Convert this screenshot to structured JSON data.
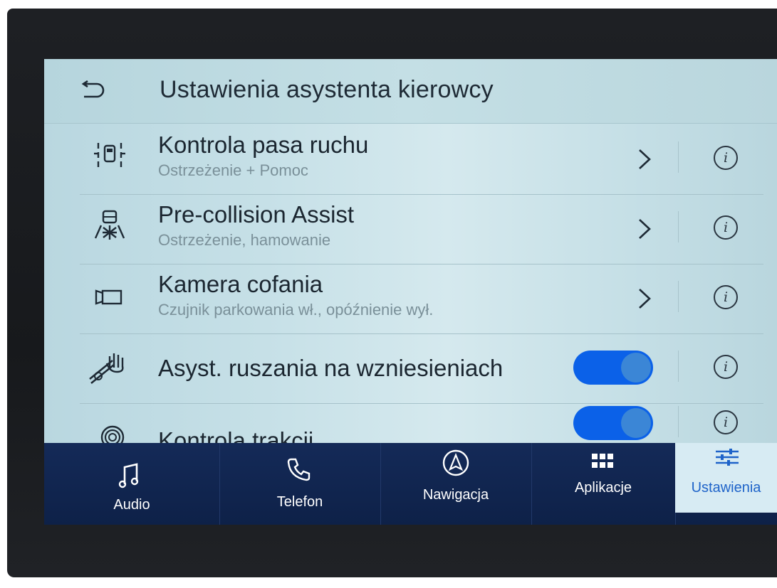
{
  "header": {
    "title": "Ustawienia asystenta kierowcy",
    "back_icon": "back-arrow-icon"
  },
  "settings": [
    {
      "label": "Kontrola pasa ruchu",
      "sublabel": "Ostrzeżenie + Pomoc",
      "icon": "lane-keeping-icon",
      "control": "chevron"
    },
    {
      "label": "Pre-collision Assist",
      "sublabel": "Ostrzeżenie, hamowanie",
      "icon": "pre-collision-icon",
      "control": "chevron"
    },
    {
      "label": "Kamera cofania",
      "sublabel": "Czujnik parkowania wł., opóźnienie wył.",
      "icon": "rear-camera-icon",
      "control": "chevron"
    },
    {
      "label": "Asyst. ruszania na wzniesieniach",
      "icon": "hill-start-icon",
      "control": "toggle",
      "enabled": true
    },
    {
      "label": "Kontrola trakcji",
      "icon": "traction-control-icon",
      "control": "toggle",
      "enabled": true
    }
  ],
  "info_glyph": "i",
  "nav": {
    "items": [
      {
        "label": "Audio",
        "icon": "music-note-icon"
      },
      {
        "label": "Telefon",
        "icon": "phone-icon"
      },
      {
        "label": "Nawigacja",
        "icon": "navigation-icon"
      },
      {
        "label": "Aplikacje",
        "icon": "apps-grid-icon"
      },
      {
        "label": "Ustawienia",
        "icon": "settings-sliders-icon",
        "active": true
      }
    ]
  },
  "colors": {
    "accent": "#1e63c9",
    "toggle_on": "#0b61e8",
    "nav_bg": "#142a58"
  }
}
